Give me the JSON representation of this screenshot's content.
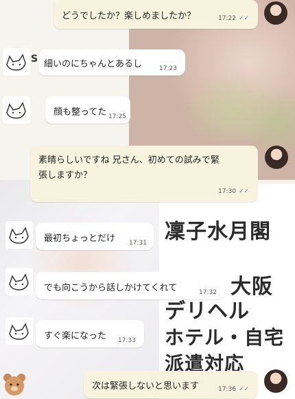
{
  "messages": [
    {
      "side": "right",
      "text": "どうでしたか？楽しめましたか？",
      "time": "17:22"
    },
    {
      "side": "left",
      "text": "細いのにちゃんとあるし",
      "time": "17:23",
      "prefix": "S"
    },
    {
      "side": "left",
      "text": "顔も整ってた",
      "time": "17:25"
    },
    {
      "side": "right",
      "text_line1": "素晴らしいですね 兄さん、初めての試みで緊",
      "text_line2": "張しますか？",
      "time": "17:30"
    },
    {
      "side": "left",
      "text": "最初ちょっとだけ",
      "time": "17:31"
    },
    {
      "side": "left",
      "text": "でも向こうから話しかけてくれて",
      "time": "17:32"
    },
    {
      "side": "left",
      "text": "すぐ楽になった",
      "time": "17:33"
    },
    {
      "side": "right",
      "text": "次は緊張しないと思います",
      "time": "17:36"
    }
  ],
  "promo": {
    "line1": "凜子水月閣",
    "line2": "大阪",
    "line3": "デリヘル",
    "line4": "ホテル・自宅",
    "line5": "派遣対応"
  },
  "read_ticks": "✓✓",
  "icons": {
    "contact_avatar": "cat-sketch-icon",
    "own_avatar": "profile-photo-avatar",
    "bear": "bear-sticker-icon"
  }
}
